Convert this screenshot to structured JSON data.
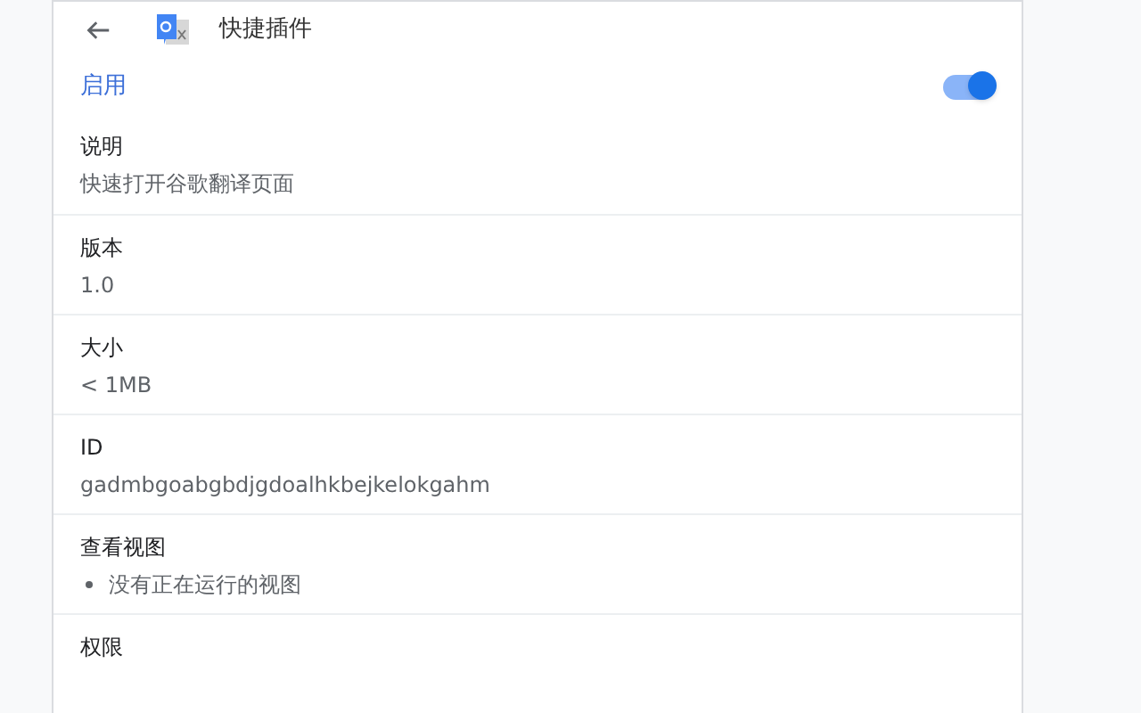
{
  "header": {
    "title": "快捷插件"
  },
  "enable": {
    "label": "启用",
    "on": true
  },
  "sections": [
    {
      "title": "说明",
      "value": "快速打开谷歌翻译页面"
    },
    {
      "title": "版本",
      "value": "1.0"
    },
    {
      "title": "大小",
      "value": "< 1MB"
    },
    {
      "title": "ID",
      "value": "gadmbgoabgbdjgdoalhkbejkelokgahm"
    },
    {
      "title": "查看视图",
      "items": [
        "没有正在运行的视图"
      ]
    },
    {
      "title": "权限"
    }
  ]
}
